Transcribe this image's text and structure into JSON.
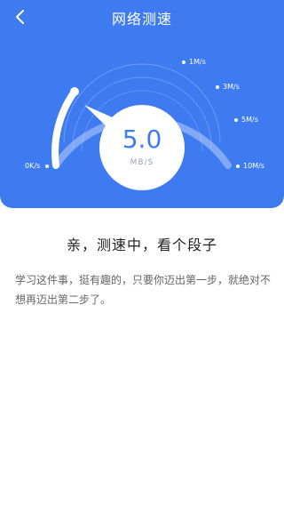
{
  "header": {
    "title": "网络测速",
    "back_icon": "chevron-left-icon"
  },
  "gauge": {
    "speed_value": "5.0",
    "speed_unit": "MB/S",
    "level_fraction": 0.18,
    "ticks": [
      "0K/s",
      "1M/s",
      "3M/s",
      "5M/s",
      "10M/s"
    ]
  },
  "content": {
    "headline": "亲，测速中，看个段子",
    "quote": "学习这件事，挺有趣的，只要你迈出第一步，就绝对不想再迈出第二步了。"
  },
  "colors": {
    "primary": "#3e7bf0",
    "background": "#ffffff"
  }
}
